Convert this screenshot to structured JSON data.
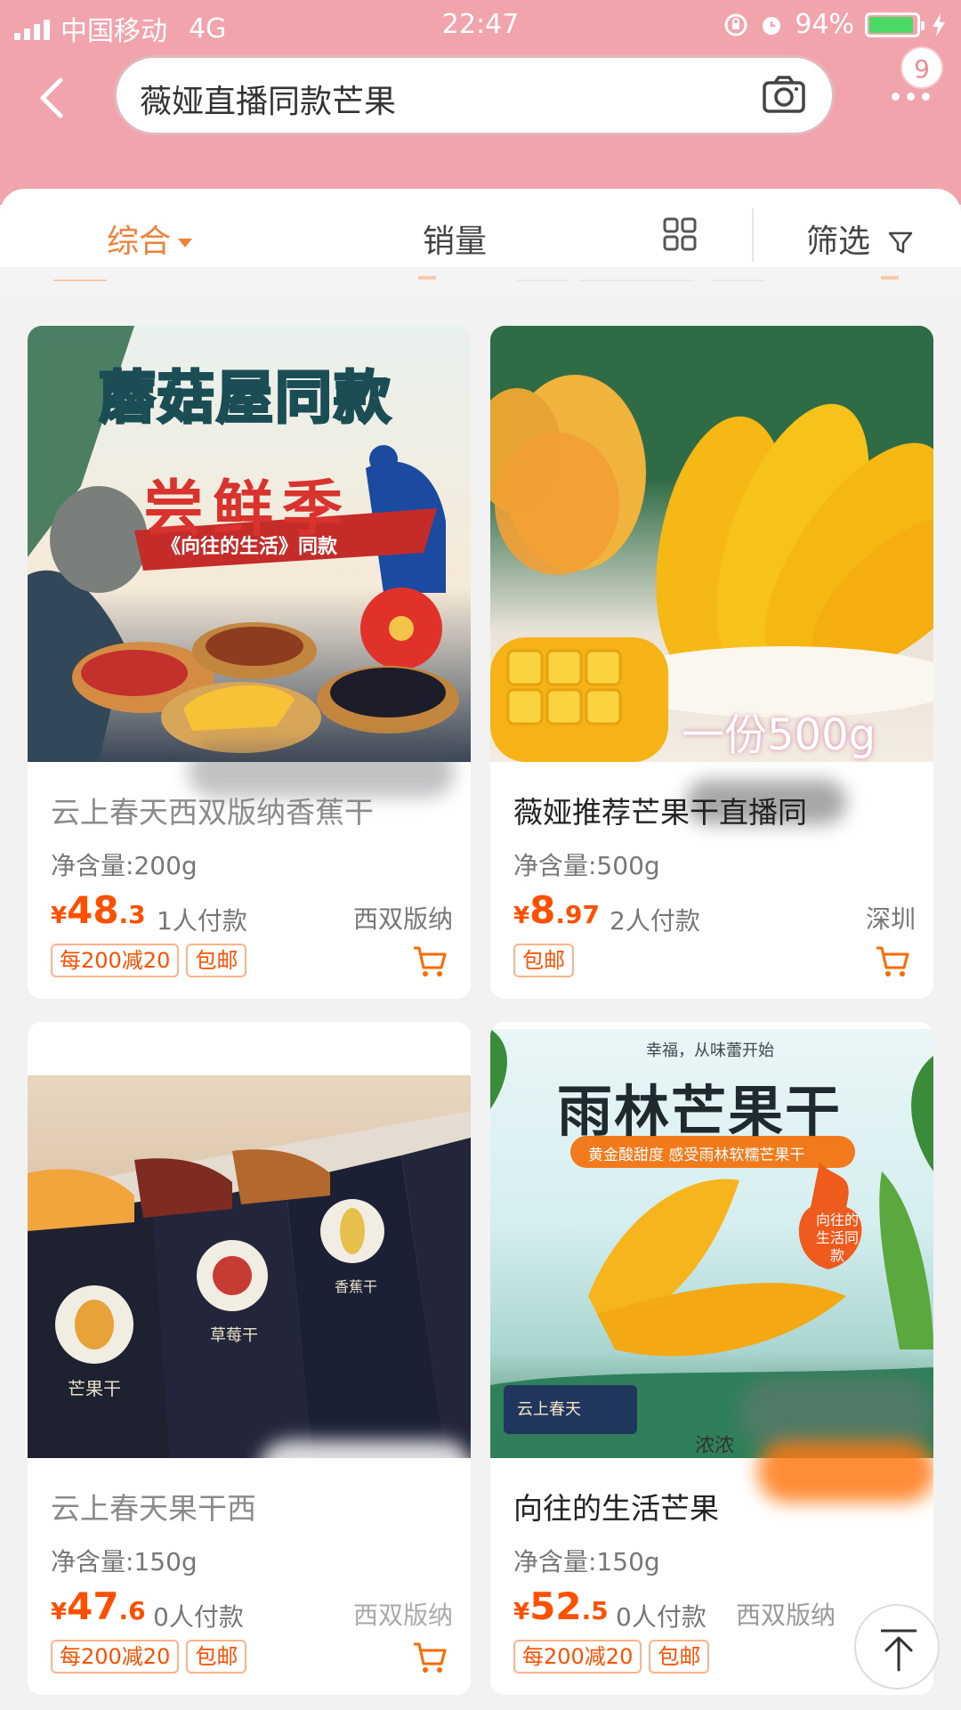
{
  "status_bar": {
    "carrier": "中国移动",
    "network": "4G",
    "time": "22:47",
    "battery_percent": "94%",
    "battery_level": 0.94
  },
  "header": {
    "search_query": "薇娅直播同款芒果",
    "more_badge": "9"
  },
  "filter_bar": {
    "tabs": [
      {
        "label": "综合"
      },
      {
        "label": "销量"
      },
      {
        "label": "筛选"
      }
    ]
  },
  "colors": {
    "header_pink": "#f1a4ab",
    "accent_orange": "#f0813a",
    "price_orange": "#ff5000"
  },
  "products": [
    {
      "title": "云上春天西双版纳香蕉干",
      "spec": "净含量:200g",
      "currency": "¥",
      "price_int": "48",
      "price_dec": ".3",
      "buyers": "1人付款",
      "location": "西双版纳",
      "tags": [
        "每200减20",
        "包邮"
      ],
      "image_text": {
        "headline": "蘑菇屋同款",
        "sub": "尝鲜季",
        "banner": "《向往的生活》同款"
      }
    },
    {
      "title": "薇娅推荐芒果干直播同",
      "spec": "净含量:500g",
      "currency": "¥",
      "price_int": "8",
      "price_dec": ".97",
      "buyers": "2人付款",
      "location": "深圳",
      "tags": [
        "包邮"
      ],
      "image_text": {
        "weight": "一份500g"
      }
    },
    {
      "title": "云上春天果干西",
      "spec": "净含量:150g",
      "currency": "¥",
      "price_int": "47",
      "price_dec": ".6",
      "buyers": "0人付款",
      "location": "西双版纳",
      "tags": [
        "每200减20",
        "包邮"
      ],
      "image_text": {
        "box1": "芒果干",
        "box2": "草莓干",
        "box3": "香蕉干"
      }
    },
    {
      "title": "向往的生活芒果",
      "spec": "净含量:150g",
      "currency": "¥",
      "price_int": "52",
      "price_dec": ".5",
      "buyers": "0人付款",
      "location": "西双版纳",
      "tags": [
        "每200减20",
        "包邮"
      ],
      "image_text": {
        "top": "幸福，从味蕾开始",
        "headline": "雨林芒果干",
        "sub": "黄金酸甜度 感受雨林软糯芒果干",
        "flame": "向往的生活同款",
        "brand": "云上春天",
        "footer": "浓浓"
      }
    }
  ]
}
